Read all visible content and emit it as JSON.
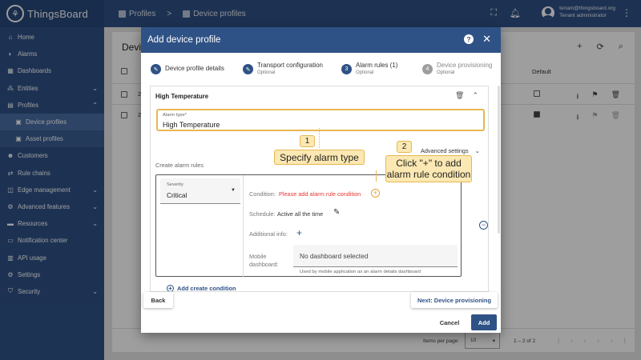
{
  "app": {
    "title": "ThingsBoard"
  },
  "sidebar": {
    "items": [
      {
        "label": "Home",
        "icon": "home-icon"
      },
      {
        "label": "Alarms",
        "icon": "bell-icon"
      },
      {
        "label": "Dashboards",
        "icon": "dashboard-icon"
      },
      {
        "label": "Entities",
        "icon": "entities-icon",
        "expandable": true
      },
      {
        "label": "Profiles",
        "icon": "profiles-icon",
        "expanded": true
      },
      {
        "label": "Device profiles",
        "icon": "device-profile-icon",
        "sub": true,
        "active": true
      },
      {
        "label": "Asset profiles",
        "icon": "asset-profile-icon",
        "sub": true
      },
      {
        "label": "Customers",
        "icon": "customers-icon"
      },
      {
        "label": "Rule chains",
        "icon": "rule-chain-icon"
      },
      {
        "label": "Edge management",
        "icon": "edge-icon",
        "expandable": true
      },
      {
        "label": "Advanced features",
        "icon": "advanced-icon",
        "expandable": true
      },
      {
        "label": "Resources",
        "icon": "folder-icon",
        "expandable": true
      },
      {
        "label": "Notification center",
        "icon": "notification-icon"
      },
      {
        "label": "API usage",
        "icon": "api-usage-icon"
      },
      {
        "label": "Settings",
        "icon": "gear-icon"
      },
      {
        "label": "Security",
        "icon": "shield-icon",
        "expandable": true
      }
    ]
  },
  "header": {
    "breadcrumb": [
      "Profiles",
      "Device profiles"
    ],
    "user": {
      "email": "tenant@thingsboard.org",
      "role": "Tenant administrator"
    }
  },
  "background": {
    "title_partial": "Devic",
    "column_default": "Default",
    "row_prefix": "2",
    "items_per_page_label": "Items per page:",
    "items_per_page": "10",
    "range": "1 – 2 of 2"
  },
  "dialog": {
    "title": "Add device profile",
    "steps": [
      {
        "num": "1",
        "label": "Device profile details",
        "sub": "",
        "state": "done"
      },
      {
        "num": "2",
        "label": "Transport configuration",
        "sub": "Optional",
        "state": "done"
      },
      {
        "num": "3",
        "label": "Alarm rules (1)",
        "sub": "Optional",
        "state": "current"
      },
      {
        "num": "4",
        "label": "Device provisioning",
        "sub": "Optional",
        "state": "pending"
      }
    ],
    "alarm": {
      "header": "High Temperature",
      "type_label": "Alarm type*",
      "type_value": "High Temperature",
      "advanced_settings": "Advanced settings",
      "create_rules_label": "Create alarm rules",
      "severity_label": "Severity",
      "severity_value": "Critical",
      "condition_label": "Condition:",
      "condition_value": "Please add alarm rule condition",
      "schedule_label": "Schedule:",
      "schedule_value": "Active all the time",
      "additional_info_label": "Additional info:",
      "mobile_dashboard_label_1": "Mobile",
      "mobile_dashboard_label_2": "dashboard:",
      "dashboard_placeholder": "No dashboard selected",
      "dashboard_hint": "Used by mobile application as an alarm details dashboard",
      "add_condition": "Add create condition"
    },
    "buttons": {
      "back": "Back",
      "next": "Next: Device provisioning",
      "cancel": "Cancel",
      "add": "Add"
    }
  },
  "callouts": [
    {
      "num": "1",
      "text": "Specify alarm type"
    },
    {
      "num": "2",
      "text_line1": "Click \"+\" to add",
      "text_line2": "alarm rule condition"
    }
  ],
  "colors": {
    "primary": "#2f5286",
    "callout": "#fce8b2",
    "callout_border": "#e6b850",
    "warning_text": "#e53935"
  }
}
